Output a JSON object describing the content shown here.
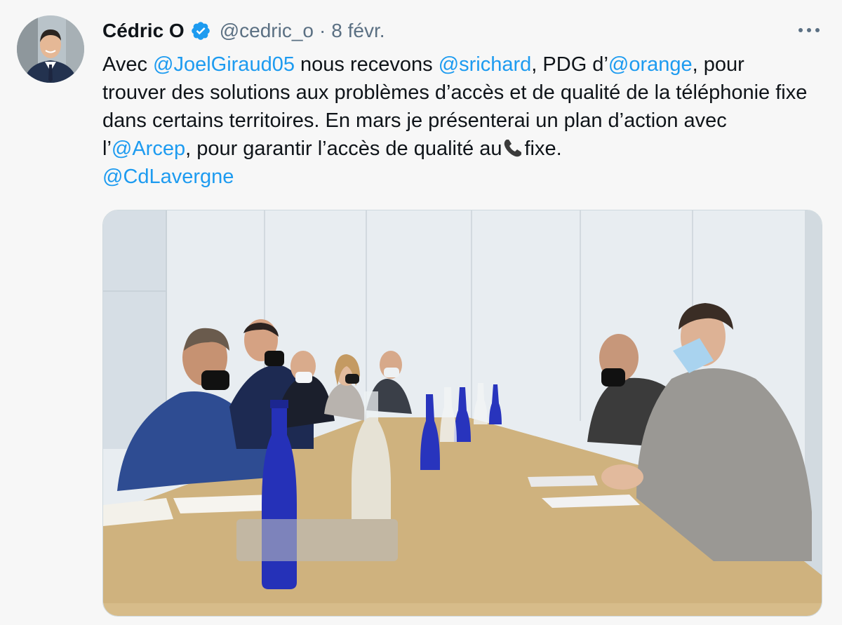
{
  "author": {
    "name": "Cédric O",
    "handle": "@cedric_o",
    "separator": "·",
    "date": "8 févr."
  },
  "tweet": {
    "seg1": "Avec ",
    "mention1": "@JoelGiraud05",
    "seg2": " nous recevons ",
    "mention2": "@srichard",
    "seg3": ", PDG d’",
    "mention3": "@orange",
    "seg4": ", pour trouver des solutions aux problèmes d’accès et de qualité de la téléphonie fixe dans certains territoires. En mars je présenterai un plan d’action avec l’",
    "mention4": "@Arcep",
    "seg5": ", pour garantir l’accès de qualité au",
    "seg6": "fixe.",
    "mention5": "@CdLavergne"
  },
  "icons": {
    "verified": "verified-badge-icon",
    "more": "more-options-icon",
    "phone": "telephone-receiver-emoji"
  },
  "colors": {
    "link": "#1d9bf0",
    "secondary_text": "#5b7083",
    "primary_text": "#0f1419",
    "background": "#f7f7f7"
  }
}
